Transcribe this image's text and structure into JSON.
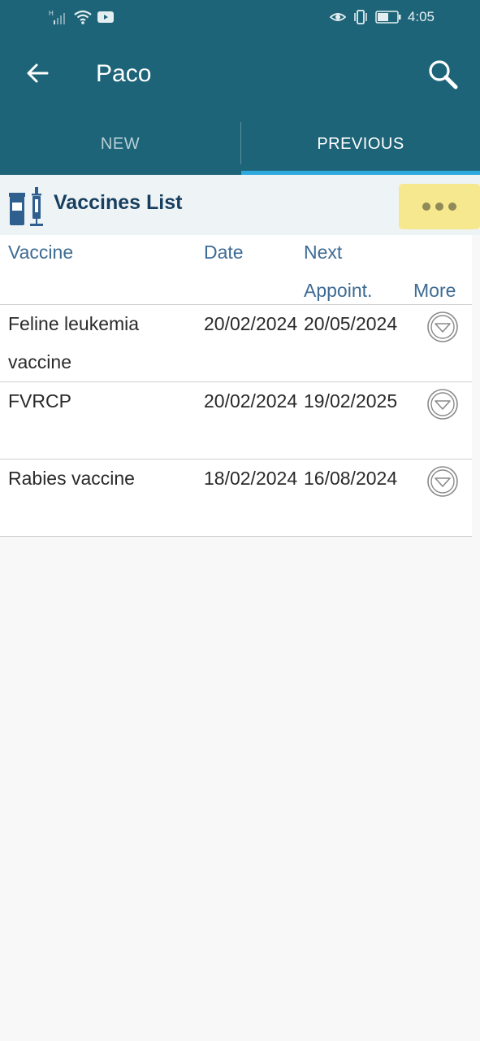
{
  "status_bar": {
    "left_icons": [
      "hd-icon",
      "signal-icon",
      "wifi-icon",
      "youtube-icon"
    ],
    "right_icons": [
      "eye-icon",
      "vibrate-icon",
      "battery-icon"
    ],
    "time": "4:05"
  },
  "app_bar": {
    "title": "Paco",
    "background_color": "#1e6478"
  },
  "tabs": [
    {
      "label": "NEW",
      "selected": false
    },
    {
      "label": "PREVIOUS",
      "selected": true
    }
  ],
  "section": {
    "title": "Vaccines List",
    "menu_color": "#f5e88e"
  },
  "table": {
    "headers": {
      "vaccine": "Vaccine",
      "date": "Date",
      "next_line1": "Next",
      "next_line2": "Appoint.",
      "more": "More"
    },
    "rows": [
      {
        "vaccine": "Feline leukemia vaccine",
        "date": "20/02/2024",
        "next": "20/05/2024"
      },
      {
        "vaccine": "FVRCP",
        "date": "20/02/2024",
        "next": "19/02/2025"
      },
      {
        "vaccine": "Rabies vaccine",
        "date": "18/02/2024",
        "next": "16/08/2024"
      }
    ]
  }
}
